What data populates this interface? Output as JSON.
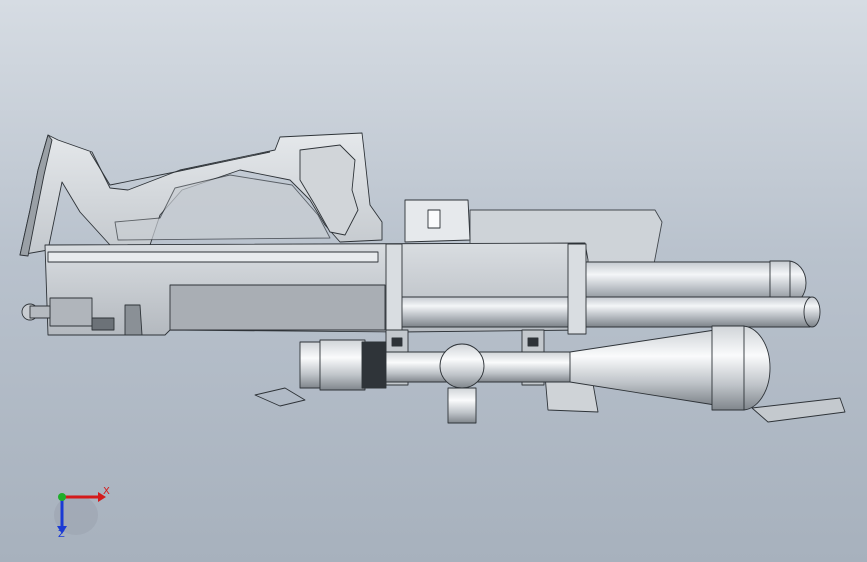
{
  "triad": {
    "x_label": "X",
    "z_label": "Z",
    "colors": {
      "x": "#d41a1a",
      "y": "#1fae2a",
      "z": "#1a3ad4"
    }
  },
  "colors": {
    "background_top": "#d6dce3",
    "background_bottom": "#a7b1bd",
    "metal_light": "#e6e9ec",
    "metal_dark": "#8c9298",
    "outline": "#2e3338"
  }
}
